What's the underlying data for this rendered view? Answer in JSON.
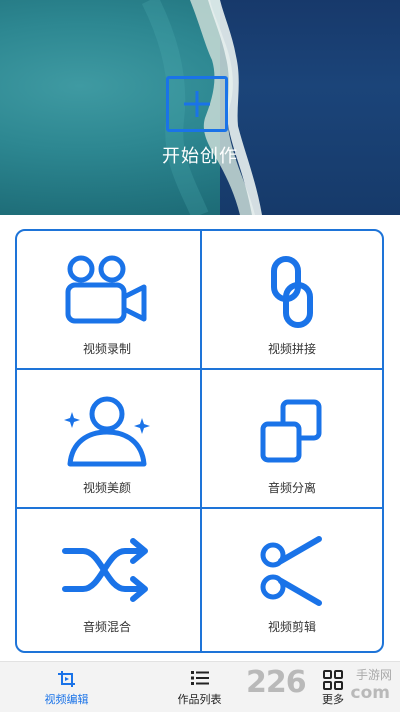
{
  "hero": {
    "start_label": "开始创作"
  },
  "grid": {
    "items": [
      {
        "label": "视频录制",
        "icon": "video-camera-icon"
      },
      {
        "label": "视频拼接",
        "icon": "link-chain-icon"
      },
      {
        "label": "视频美颜",
        "icon": "beauty-person-icon"
      },
      {
        "label": "音频分离",
        "icon": "separate-squares-icon"
      },
      {
        "label": "音频混合",
        "icon": "shuffle-icon"
      },
      {
        "label": "视频剪辑",
        "icon": "scissors-icon"
      }
    ]
  },
  "tabbar": {
    "tabs": [
      {
        "label": "视频编辑",
        "icon": "crop-play-icon",
        "active": true
      },
      {
        "label": "作品列表",
        "icon": "list-icon",
        "active": false
      },
      {
        "label": "更多",
        "icon": "grid-icon",
        "active": false
      }
    ]
  },
  "watermark": {
    "brand": "226",
    "cn": "手游网",
    "suffix": "com"
  },
  "colors": {
    "accent": "#1a73e8",
    "border": "#1e74d8",
    "label": "#333333"
  }
}
